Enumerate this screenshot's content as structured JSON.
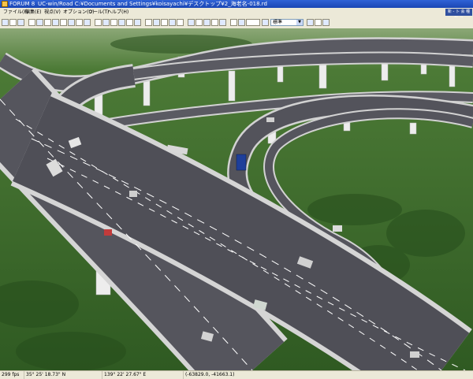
{
  "window": {
    "app_title": "FORUM 8",
    "title": "UC-win/Road  C:¥Documents and Settings¥koisayachi¥デスクトップ¥2_海老名-018.rd"
  },
  "menu": {
    "items": [
      "ファイル(F)",
      "編集(E)",
      "視点(V)",
      "オプション(O)",
      "ツール(T)",
      "ヘルプ(H)"
    ],
    "overlay_label": "新 - 卜 会 種 所 ス"
  },
  "toolbar": {
    "dropdown_value": "標準",
    "dropdown_arrow": "▼"
  },
  "status": {
    "fps": "299 fps",
    "latitude": "35°  25' 18.73\" N",
    "longitude": "139°  22' 27.67\" E",
    "coordinates": "(-63829.0, -41663.1)"
  },
  "scene": {
    "sky_color": "#8ba776",
    "ground_color": "#3d6b2b",
    "road_color": "#55555d",
    "barrier_color": "#d6d6d6",
    "pier_color": "#ececec"
  }
}
